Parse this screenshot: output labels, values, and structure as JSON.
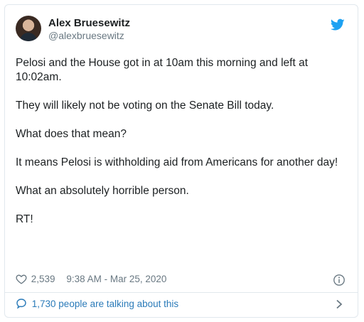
{
  "author": {
    "display_name": "Alex Bruesewitz",
    "handle": "@alexbruesewitz"
  },
  "tweet": {
    "paragraphs": [
      "Pelosi and the House got in at 10am this morning and left at 10:02am.",
      "They will likely not be voting on the Senate Bill today.",
      "What does that mean?",
      "It means Pelosi is withholding aid from Americans for another day!",
      "What an absolutely horrible person.",
      "RT!"
    ]
  },
  "meta": {
    "likes": "2,539",
    "timestamp": "9:38 AM - Mar 25, 2020"
  },
  "footer": {
    "talking": "1,730 people are talking about this"
  },
  "icons": {
    "brand": "twitter-bird-icon",
    "like": "heart-icon",
    "info": "info-icon",
    "comment": "speech-bubble-icon",
    "more": "chevron-right-icon"
  },
  "colors": {
    "twitter_blue": "#1da1f2",
    "link_blue": "#2b7bb9",
    "muted_gray": "#697882",
    "border": "#e1e8ed"
  }
}
